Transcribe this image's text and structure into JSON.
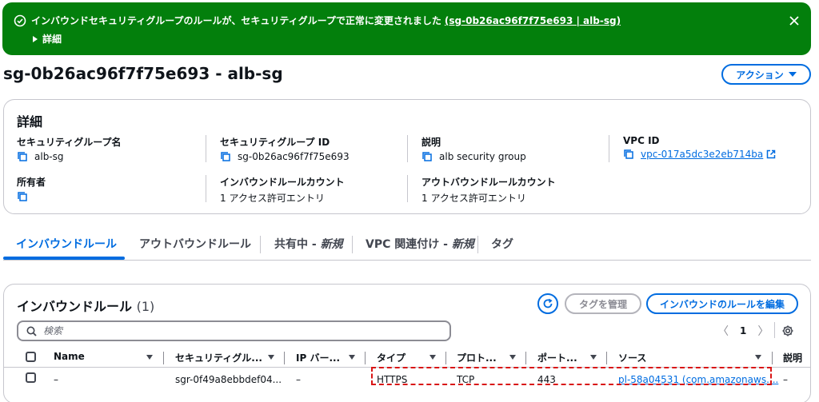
{
  "flash": {
    "message": "インバウンドセキュリティグループのルールが、セキュリティグループで正常に変更されました",
    "link": "(sg-0b26ac96f7f75e693 | alb-sg)",
    "details_label": "詳細"
  },
  "header": {
    "title": "sg-0b26ac96f7f75e693 - alb-sg",
    "actions_label": "アクション"
  },
  "details": {
    "heading": "詳細",
    "sg_name_label": "セキュリティグループ名",
    "sg_name_value": "alb-sg",
    "sg_id_label": "セキュリティグループ ID",
    "sg_id_value": "sg-0b26ac96f7f75e693",
    "description_label": "説明",
    "description_value": "alb security group",
    "vpc_id_label": "VPC ID",
    "vpc_id_value": "vpc-017a5dc3e2eb714ba",
    "owner_label": "所有者",
    "inbound_count_label": "インバウンドルールカウント",
    "inbound_count_value": "1 アクセス許可エントリ",
    "outbound_count_label": "アウトバウンドルールカウント",
    "outbound_count_value": "1 アクセス許可エントリ"
  },
  "tabs": {
    "inbound": "インバウンドルール",
    "outbound": "アウトバウンドルール",
    "sharing": "共有中 - ",
    "sharing_new": "新規",
    "vpc_assoc": "VPC 関連付け - ",
    "vpc_assoc_new": "新規",
    "tags": "タグ"
  },
  "rules": {
    "title": "インバウンドルール",
    "count": "(1)",
    "manage_tags_label": "タグを管理",
    "edit_label": "インバウンドのルールを編集",
    "search_placeholder": "検索",
    "page": "1",
    "columns": {
      "name": "Name",
      "rule_id": "セキュリティグル...",
      "ip_version": "IP バー...",
      "type": "タイプ",
      "protocol": "プロト...",
      "port": "ポート...",
      "source": "ソース",
      "description": "説明"
    },
    "rows": [
      {
        "name": "–",
        "rule_id": "sgr-0f49a8ebbdef04...",
        "ip_version": "–",
        "type": "HTTPS",
        "protocol": "TCP",
        "port": "443",
        "source": "pl-58a04531 (com.amazonaws....",
        "description": "–"
      }
    ]
  },
  "colors": {
    "success": "#037f0c",
    "primary": "#006ce0",
    "highlight": "#d91515"
  }
}
